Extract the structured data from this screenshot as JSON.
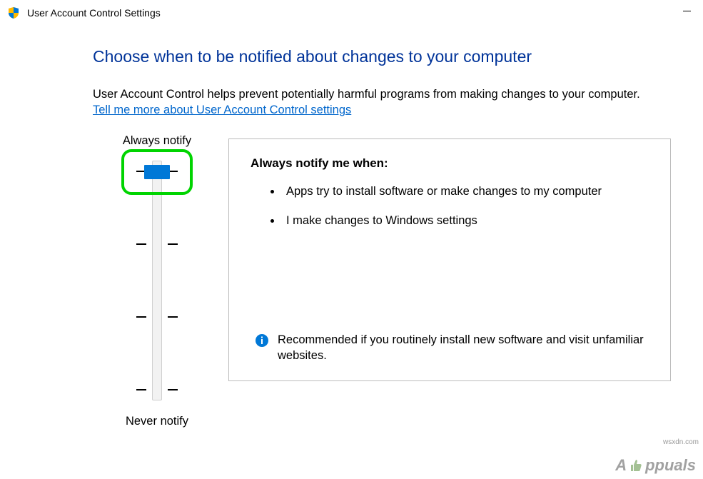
{
  "window": {
    "title": "User Account Control Settings"
  },
  "heading": "Choose when to be notified about changes to your computer",
  "description": "User Account Control helps prevent potentially harmful programs from making changes to your computer.",
  "link_text": "Tell me more about User Account Control settings",
  "slider": {
    "top_label": "Always notify",
    "bottom_label": "Never notify",
    "level": 3,
    "levels_total": 4
  },
  "panel": {
    "title": "Always notify me when:",
    "bullets": [
      "Apps try to install software or make changes to my computer",
      "I make changes to Windows settings"
    ],
    "recommendation": "Recommended if you routinely install new software and visit unfamiliar websites."
  },
  "watermark": {
    "brand": "A  ppuals",
    "source": "wsxdn.com"
  },
  "colors": {
    "heading": "#003399",
    "link": "#0066cc",
    "slider_thumb": "#0078d7",
    "highlight": "#00d400"
  }
}
